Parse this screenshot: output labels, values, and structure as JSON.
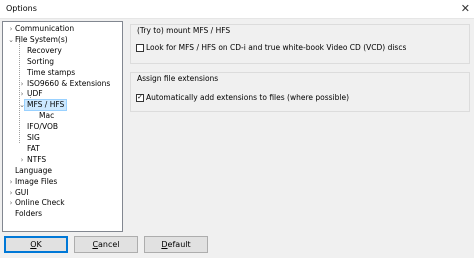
{
  "window": {
    "title": "Options",
    "close_glyph": "✕"
  },
  "tree": {
    "items": [
      {
        "label": "Communication",
        "level": 0,
        "arrow": "›"
      },
      {
        "label": "File System(s)",
        "level": 0,
        "arrow": "⌄"
      },
      {
        "label": "Recovery",
        "level": 1,
        "arrow": ""
      },
      {
        "label": "Sorting",
        "level": 1,
        "arrow": ""
      },
      {
        "label": "Time stamps",
        "level": 1,
        "arrow": ""
      },
      {
        "label": "ISO9660 & Extensions",
        "level": 1,
        "arrow": "›"
      },
      {
        "label": "UDF",
        "level": 1,
        "arrow": "›"
      },
      {
        "label": "MFS / HFS",
        "level": 1,
        "arrow": "⌄",
        "selected": true
      },
      {
        "label": "Mac",
        "level": 2,
        "arrow": ""
      },
      {
        "label": "IFO/VOB",
        "level": 1,
        "arrow": ""
      },
      {
        "label": "SIG",
        "level": 1,
        "arrow": ""
      },
      {
        "label": "FAT",
        "level": 1,
        "arrow": ""
      },
      {
        "label": "NTFS",
        "level": 1,
        "arrow": "›"
      },
      {
        "label": "Language",
        "level": 0,
        "arrow": ""
      },
      {
        "label": "Image Files",
        "level": 0,
        "arrow": "›"
      },
      {
        "label": "GUI",
        "level": 0,
        "arrow": "›"
      },
      {
        "label": "Online Check",
        "level": 0,
        "arrow": "›"
      },
      {
        "label": "Folders",
        "level": 0,
        "arrow": ""
      }
    ]
  },
  "groups": {
    "mount": {
      "title": "(Try to) mount MFS / HFS",
      "checkbox_label": "Look for MFS / HFS on CD-i and true white-book Video CD (VCD) discs",
      "checked": false
    },
    "extensions": {
      "title": "Assign file extensions",
      "checkbox_label": "Automatically add extensions to files (where possible)",
      "checked": true
    }
  },
  "buttons": {
    "ok": {
      "mnemonic": "O",
      "rest": "K"
    },
    "cancel": {
      "mnemonic": "C",
      "rest": "ancel"
    },
    "default": {
      "mnemonic": "D",
      "rest": "efault"
    }
  },
  "check_glyph": "✓"
}
